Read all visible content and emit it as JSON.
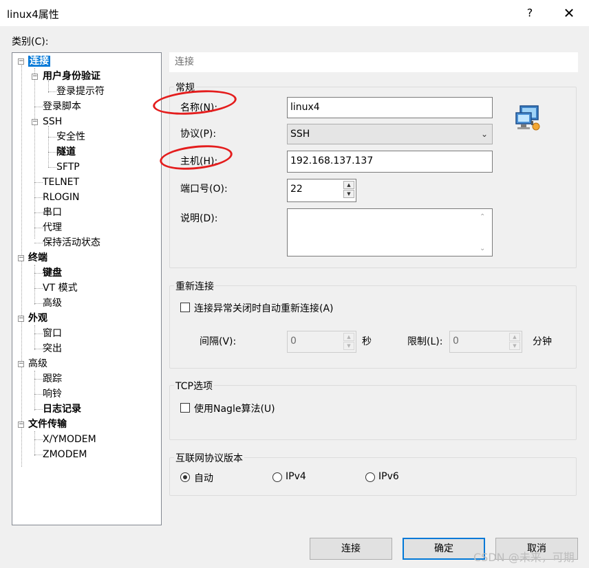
{
  "window": {
    "title": "linux4属性",
    "help": "?",
    "close": "✕"
  },
  "category_label": "类别(C):",
  "tree": [
    {
      "label": "连接",
      "bold": true,
      "selected": true
    },
    {
      "label": "用户身份验证",
      "bold": true
    },
    {
      "label": "登录提示符",
      "bold": false
    },
    {
      "label": "登录脚本",
      "bold": false
    },
    {
      "label": "SSH",
      "bold": false
    },
    {
      "label": "安全性",
      "bold": false
    },
    {
      "label": "隧道",
      "bold": true
    },
    {
      "label": "SFTP",
      "bold": false
    },
    {
      "label": "TELNET",
      "bold": false
    },
    {
      "label": "RLOGIN",
      "bold": false
    },
    {
      "label": "串口",
      "bold": false
    },
    {
      "label": "代理",
      "bold": false
    },
    {
      "label": "保持活动状态",
      "bold": false
    },
    {
      "label": "终端",
      "bold": true
    },
    {
      "label": "键盘",
      "bold": true
    },
    {
      "label": "VT 模式",
      "bold": false
    },
    {
      "label": "高级",
      "bold": false
    },
    {
      "label": "外观",
      "bold": true
    },
    {
      "label": "窗口",
      "bold": false
    },
    {
      "label": "突出",
      "bold": false
    },
    {
      "label": "高级",
      "bold": false
    },
    {
      "label": "跟踪",
      "bold": false
    },
    {
      "label": "响铃",
      "bold": false
    },
    {
      "label": "日志记录",
      "bold": true
    },
    {
      "label": "文件传输",
      "bold": true
    },
    {
      "label": "X/YMODEM",
      "bold": false
    },
    {
      "label": "ZMODEM",
      "bold": false
    }
  ],
  "panel_header": "连接",
  "general": {
    "title": "常规",
    "name_label": "名称(N):",
    "name_value": "linux4",
    "protocol_label": "协议(P):",
    "protocol_value": "SSH",
    "host_label": "主机(H):",
    "host_value": "192.168.137.137",
    "port_label": "端口号(O):",
    "port_value": "22",
    "desc_label": "说明(D):",
    "desc_value": ""
  },
  "reconnect": {
    "title": "重新连接",
    "checkbox_label": "连接异常关闭时自动重新连接(A)",
    "interval_label": "间隔(V):",
    "interval_value": "0",
    "interval_unit": "秒",
    "limit_label": "限制(L):",
    "limit_value": "0",
    "limit_unit": "分钟"
  },
  "tcp": {
    "title": "TCP选项",
    "nagle_label": "使用Nagle算法(U)"
  },
  "ip_version": {
    "title": "互联网协议版本",
    "options": [
      "自动",
      "IPv4",
      "IPv6"
    ],
    "selected": "自动"
  },
  "buttons": {
    "connect": "连接",
    "ok": "确定",
    "cancel": "取消"
  },
  "watermark": "CSDN @未来，可期",
  "colors": {
    "selection": "#0078d7",
    "annotation": "#e41d1d"
  }
}
